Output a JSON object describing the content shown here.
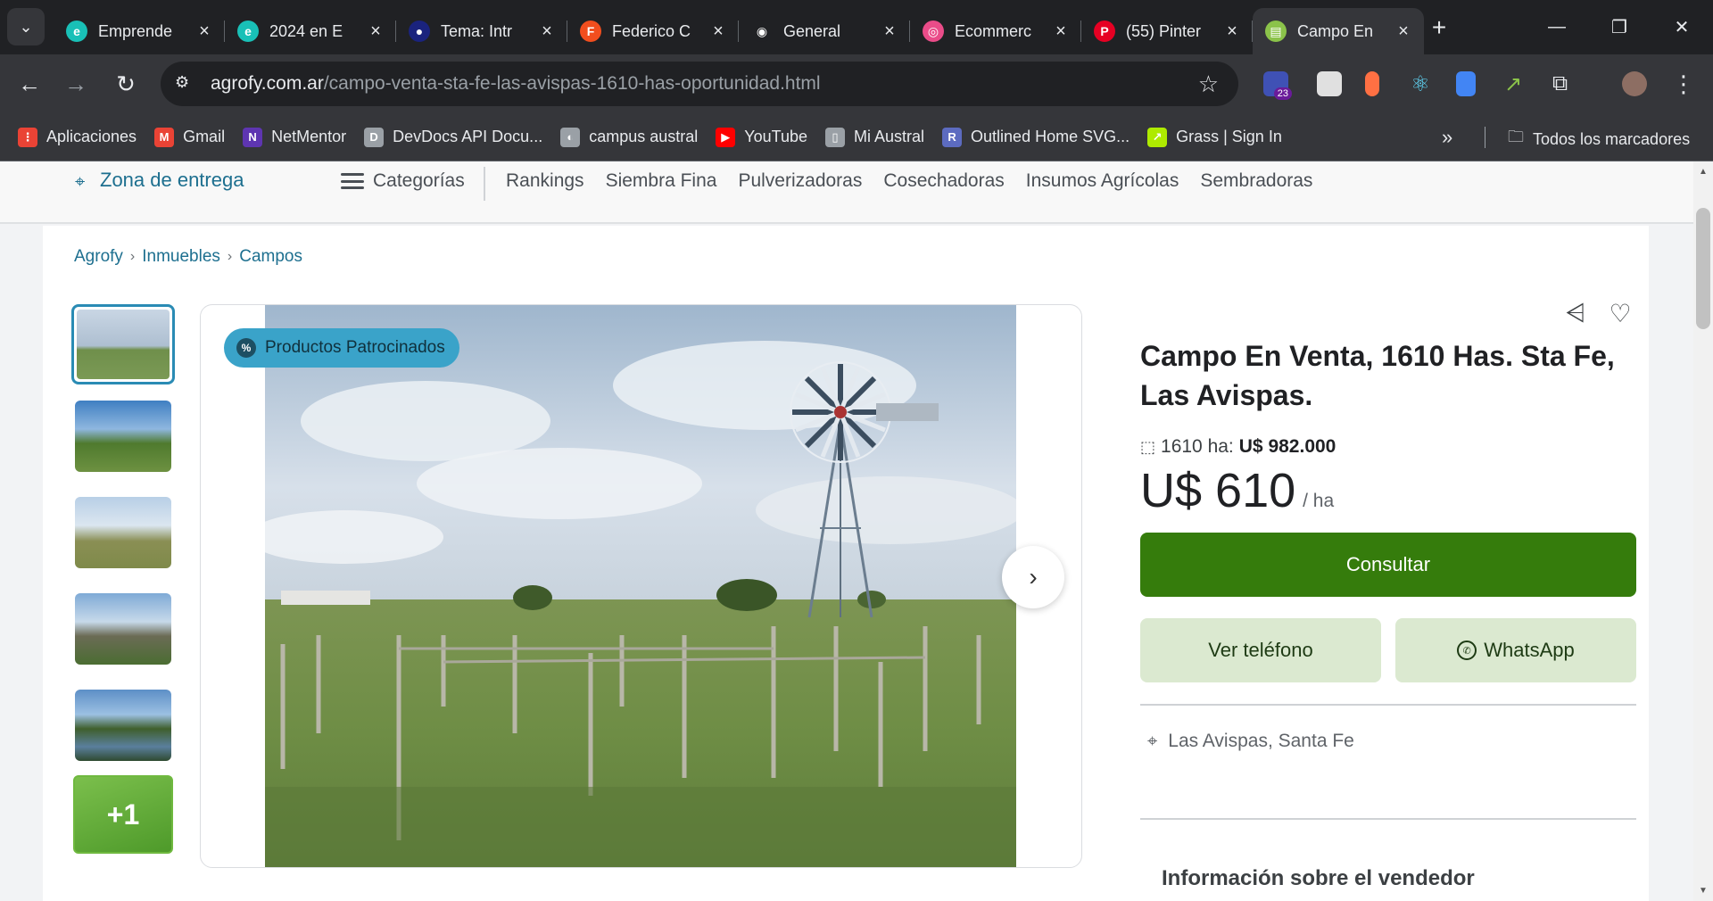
{
  "browser": {
    "tabs": [
      {
        "title": "Emprende",
        "color": "#19c0b7",
        "glyph": "e"
      },
      {
        "title": "2024 en E",
        "color": "#19c0b7",
        "glyph": "e"
      },
      {
        "title": "Tema: Intr",
        "color": "#1a237e",
        "glyph": "●"
      },
      {
        "title": "Federico C",
        "color": "#f24e1e",
        "glyph": "F"
      },
      {
        "title": "General",
        "color": "#202124",
        "glyph": "◉"
      },
      {
        "title": "Ecommerc",
        "color": "#ea4c89",
        "glyph": "◎"
      },
      {
        "title": "(55) Pinter",
        "color": "#e60023",
        "glyph": "P"
      },
      {
        "title": "Campo En",
        "color": "#8bc34a",
        "glyph": "▤"
      }
    ],
    "new_tab": "+",
    "window_controls": {
      "minimize": "—",
      "restore": "❐",
      "close": "✕"
    },
    "url": {
      "domain": "agrofy.com.ar",
      "path": "/campo-venta-sta-fe-las-avispas-1610-has-oportunidad.html"
    },
    "nav": {
      "back": "←",
      "forward": "→",
      "reload": "↻"
    },
    "extension_badge": "23",
    "bookmarks": [
      {
        "label": "Aplicaciones",
        "color": "#ea4335",
        "glyph": "⋮"
      },
      {
        "label": "Gmail",
        "color": "#ea4335",
        "glyph": "M"
      },
      {
        "label": "NetMentor",
        "color": "#5e35b1",
        "glyph": "N"
      },
      {
        "label": "DevDocs API Docu...",
        "color": "#9aa0a6",
        "glyph": "D"
      },
      {
        "label": "campus austral",
        "color": "#9aa0a6",
        "glyph": "◐"
      },
      {
        "label": "YouTube",
        "color": "#ff0000",
        "glyph": "▶"
      },
      {
        "label": "Mi Austral",
        "color": "#9aa0a6",
        "glyph": "▯"
      },
      {
        "label": "Outlined Home SVG...",
        "color": "#5c6bc0",
        "glyph": "R"
      },
      {
        "label": "Grass | Sign In",
        "color": "#aeea00",
        "glyph": "↗"
      }
    ],
    "bookmarks_more": "»",
    "all_bookmarks": "Todos los marcadores"
  },
  "site": {
    "zona": "Zona de entrega",
    "categorias": "Categorías",
    "nav_links": [
      "Rankings",
      "Siembra Fina",
      "Pulverizadoras",
      "Cosechadoras",
      "Insumos Agrícolas",
      "Sembradoras"
    ],
    "breadcrumbs": [
      "Agrofy",
      "Inmuebles",
      "Campos"
    ]
  },
  "listing": {
    "badge": "Productos Patrocinados",
    "more_photos": "+1",
    "title": "Campo En Venta, 1610 Has. Sta Fe, Las Avispas.",
    "area_label": "1610 ha:",
    "total_price": "U$ 982.000",
    "price": "U$ 610",
    "price_unit": "/ ha",
    "consultar": "Consultar",
    "ver_telefono": "Ver teléfono",
    "whatsapp": "WhatsApp",
    "location": "Las Avispas, Santa Fe",
    "seller_heading": "Información sobre el vendedor"
  },
  "colors": {
    "accent_link": "#1d6f8f",
    "primary_button": "#357c0c",
    "secondary_button": "#dbe9d0",
    "badge": "#3aa3c9"
  }
}
